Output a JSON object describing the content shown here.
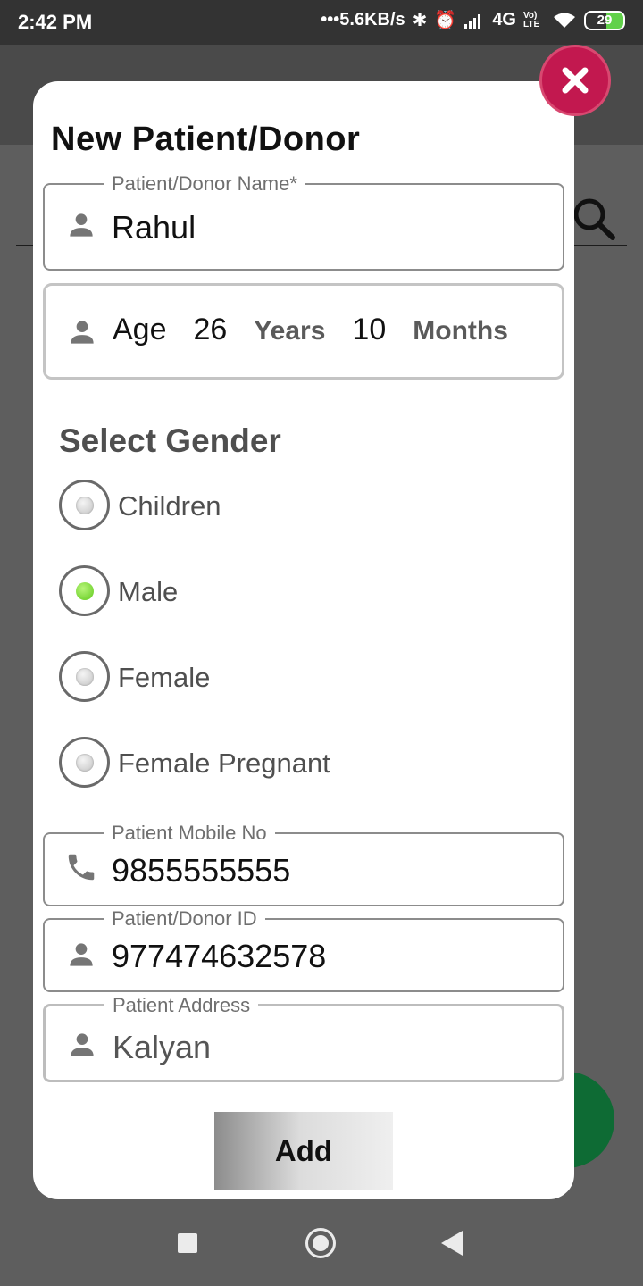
{
  "status_bar": {
    "time": "2:42 PM",
    "speed": "•••5.6KB/s",
    "network": "4G",
    "volte": "Vo) LTE",
    "battery": "29"
  },
  "dialog": {
    "title": "New Patient/Donor",
    "name_field": {
      "label": "Patient/Donor Name*",
      "value": "Rahul",
      "icon": "person-icon"
    },
    "age": {
      "label": "Age",
      "years": "26",
      "years_label": "Years",
      "months": "10",
      "months_label": "Months"
    },
    "gender": {
      "title": "Select Gender",
      "options": [
        {
          "label": "Children",
          "selected": false
        },
        {
          "label": "Male",
          "selected": true
        },
        {
          "label": "Female",
          "selected": false
        },
        {
          "label": "Female Pregnant",
          "selected": false
        }
      ]
    },
    "mobile_field": {
      "label": "Patient Mobile No",
      "value": "9855555555",
      "icon": "phone-icon"
    },
    "id_field": {
      "label": "Patient/Donor ID",
      "value": "977474632578",
      "icon": "person-icon"
    },
    "address_field": {
      "label": "Patient Address",
      "value": "Kalyan",
      "icon": "person-icon"
    },
    "add_button": "Add"
  },
  "colors": {
    "close_button": "#c2184f",
    "radio_selected": "#6fd12a",
    "fab": "#0e6b34",
    "scrim": "#5e5e5e"
  }
}
